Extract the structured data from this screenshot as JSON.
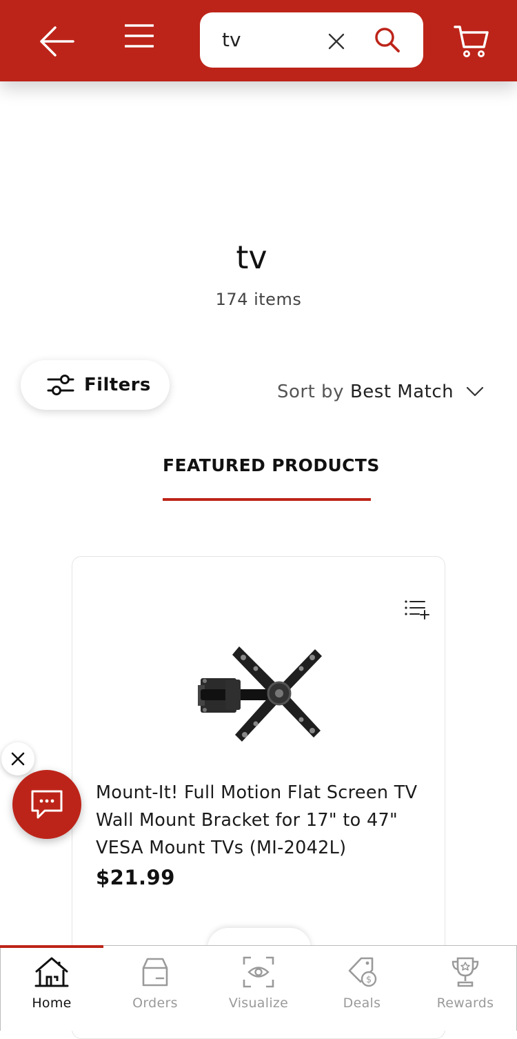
{
  "header": {
    "search_value": "tv",
    "accent_color": "#bd2419",
    "icons": [
      "arrow-left-icon",
      "hamburger-menu-icon",
      "close-icon",
      "search-icon",
      "cart-icon"
    ]
  },
  "results": {
    "query": "tv",
    "count_label": "174 items"
  },
  "controls": {
    "filters_label": "Filters",
    "sort_prefix": "Sort by",
    "sort_value": "Best Match"
  },
  "featured": {
    "tab_label": "FEATURED PRODUCTS"
  },
  "product": {
    "name": "Mount-It! Full Motion Flat Screen TV Wall Mount Bracket for 17\" to 47\" VESA Mount TVs (MI-2042L)",
    "price": "$21.99"
  },
  "nav": {
    "items": [
      {
        "label": "Home",
        "icon": "home-icon",
        "active": true
      },
      {
        "label": "Orders",
        "icon": "box-icon",
        "active": false
      },
      {
        "label": "Visualize",
        "icon": "eye-scan-icon",
        "active": false
      },
      {
        "label": "Deals",
        "icon": "price-tag-icon",
        "active": false
      },
      {
        "label": "Rewards",
        "icon": "trophy-icon",
        "active": false
      }
    ]
  }
}
